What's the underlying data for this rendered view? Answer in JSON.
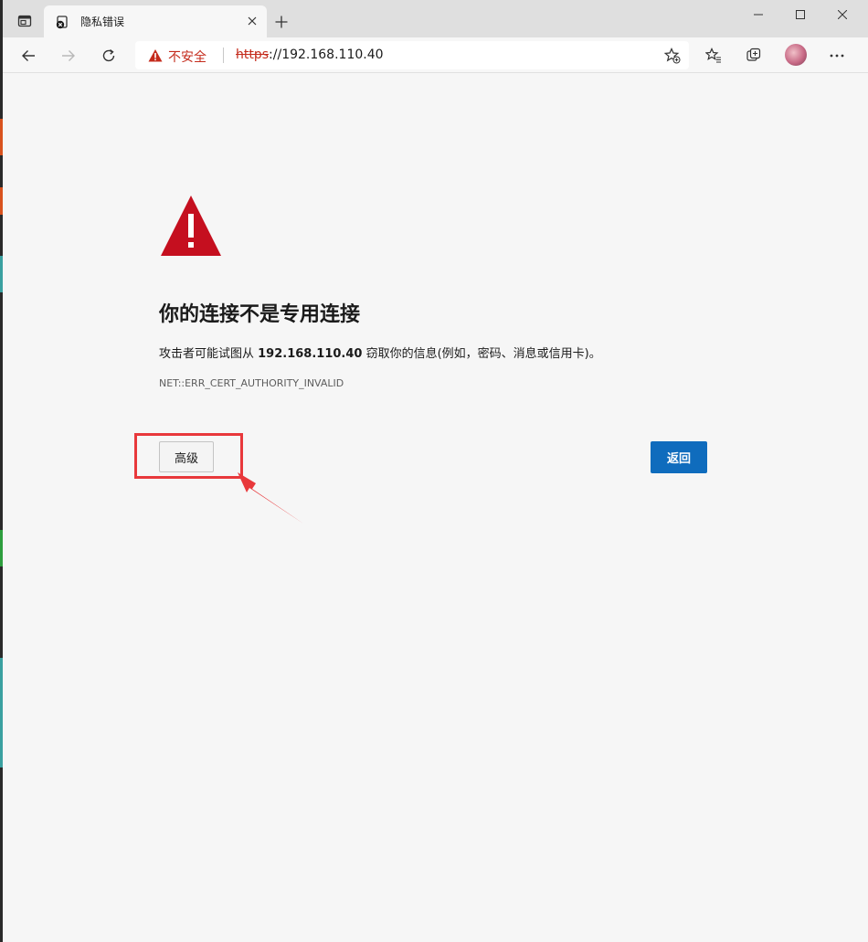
{
  "colors": {
    "accent": "#0f6cbd",
    "danger": "#c42b1c",
    "warning_icon": "#c50f1f",
    "annotation": "#e8383b"
  },
  "tab": {
    "title": "隐私错误",
    "favicon": "broken-lock-icon"
  },
  "address_bar": {
    "security_label": "不安全",
    "url_scheme": "https",
    "url_rest": "://192.168.110.40"
  },
  "error_page": {
    "title": "你的连接不是专用连接",
    "desc_before": "攻击者可能试图从 ",
    "desc_host": "192.168.110.40",
    "desc_after": " 窃取你的信息(例如，密码、消息或信用卡)。",
    "error_code": "NET::ERR_CERT_AUTHORITY_INVALID",
    "advanced_label": "高级",
    "back_label": "返回"
  }
}
